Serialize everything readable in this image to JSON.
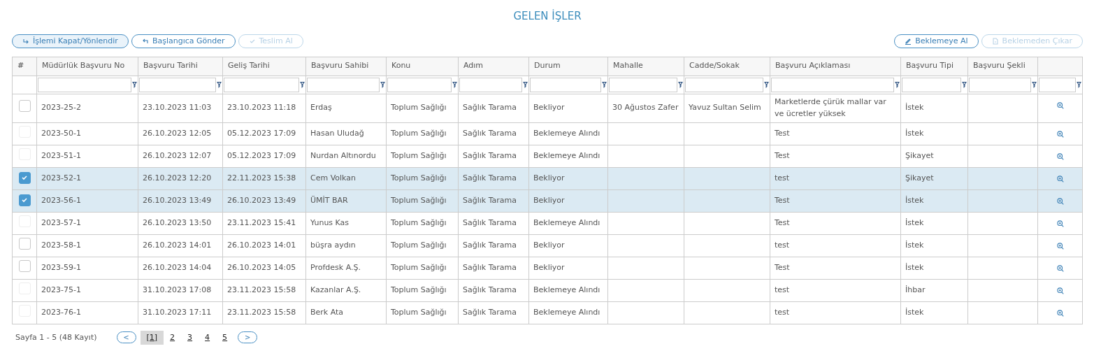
{
  "title": "GELEN İŞLER",
  "left_buttons": [
    {
      "label": "İşlemi Kapat/Yönlendir",
      "disabled": false,
      "selected": true
    },
    {
      "label": "Başlangıca Gönder",
      "disabled": false,
      "selected": false
    },
    {
      "label": "Teslim Al",
      "disabled": true,
      "selected": false
    }
  ],
  "right_buttons": [
    {
      "label": "Beklemeye Al",
      "disabled": false,
      "selected": false
    },
    {
      "label": "Beklemeden Çıkar",
      "disabled": true,
      "selected": false
    }
  ],
  "table": {
    "select_header": "#",
    "columns": [
      "Müdürlük Başvuru No",
      "Başvuru Tarihi",
      "Geliş Tarihi",
      "Başvuru Sahibi",
      "Konu",
      "Adım",
      "Durum",
      "Mahalle",
      "Cadde/Sokak",
      "Başvuru Açıklaması",
      "Başvuru Tipi",
      "Başvuru Şekli"
    ],
    "rows": [
      {
        "checked": false,
        "disabled": false,
        "cells": [
          "2023-25-2",
          "23.10.2023 11:03",
          "23.10.2023 11:18",
          "Erdaş",
          "Toplum Sağlığı",
          "Sağlık Tarama",
          "Bekliyor",
          "30 Ağustos Zafer",
          "Yavuz Sultan Selim",
          "Marketlerde çürük mallar var ve ücretler yüksek",
          "İstek",
          ""
        ]
      },
      {
        "checked": false,
        "disabled": true,
        "cells": [
          "2023-50-1",
          "26.10.2023 12:05",
          "05.12.2023 17:09",
          "Hasan Uludağ",
          "Toplum Sağlığı",
          "Sağlık Tarama",
          "Beklemeye Alındı",
          "",
          "",
          "Test",
          "İstek",
          ""
        ]
      },
      {
        "checked": false,
        "disabled": true,
        "cells": [
          "2023-51-1",
          "26.10.2023 12:07",
          "05.12.2023 17:09",
          "Nurdan Altınordu",
          "Toplum Sağlığı",
          "Sağlık Tarama",
          "Beklemeye Alındı",
          "",
          "",
          "Test",
          "Şikayet",
          ""
        ]
      },
      {
        "checked": true,
        "disabled": false,
        "cells": [
          "2023-52-1",
          "26.10.2023 12:20",
          "22.11.2023 15:38",
          "Cem Volkan",
          "Toplum Sağlığı",
          "Sağlık Tarama",
          "Bekliyor",
          "",
          "",
          "test",
          "Şikayet",
          ""
        ]
      },
      {
        "checked": true,
        "disabled": false,
        "cells": [
          "2023-56-1",
          "26.10.2023 13:49",
          "26.10.2023 13:49",
          "ÜMİT BAR",
          "Toplum Sağlığı",
          "Sağlık Tarama",
          "Bekliyor",
          "",
          "",
          "Test",
          "İstek",
          ""
        ]
      },
      {
        "checked": false,
        "disabled": true,
        "cells": [
          "2023-57-1",
          "26.10.2023 13:50",
          "23.11.2023 15:41",
          "Yunus Kas",
          "Toplum Sağlığı",
          "Sağlık Tarama",
          "Beklemeye Alındı",
          "",
          "",
          "Test",
          "İstek",
          ""
        ]
      },
      {
        "checked": false,
        "disabled": false,
        "cells": [
          "2023-58-1",
          "26.10.2023 14:01",
          "26.10.2023 14:01",
          "büşra aydın",
          "Toplum Sağlığı",
          "Sağlık Tarama",
          "Bekliyor",
          "",
          "",
          "test",
          "İstek",
          ""
        ]
      },
      {
        "checked": false,
        "disabled": false,
        "cells": [
          "2023-59-1",
          "26.10.2023 14:04",
          "26.10.2023 14:05",
          "Profdesk A.Ş.",
          "Toplum Sağlığı",
          "Sağlık Tarama",
          "Bekliyor",
          "",
          "",
          "Test",
          "İstek",
          ""
        ]
      },
      {
        "checked": false,
        "disabled": true,
        "cells": [
          "2023-75-1",
          "31.10.2023 17:08",
          "23.11.2023 15:58",
          "Kazanlar A.Ş.",
          "Toplum Sağlığı",
          "Sağlık Tarama",
          "Beklemeye Alındı",
          "",
          "",
          "test",
          "İhbar",
          ""
        ]
      },
      {
        "checked": false,
        "disabled": true,
        "cells": [
          "2023-76-1",
          "31.10.2023 17:11",
          "23.11.2023 15:58",
          "Berk Ata",
          "Toplum Sağlığı",
          "Sağlık Tarama",
          "Beklemeye Alındı",
          "",
          "",
          "test",
          "İstek",
          ""
        ]
      }
    ]
  },
  "pagination": {
    "summary": "Sayfa 1 - 5 (48 Kayıt)",
    "prev": "<",
    "next": ">",
    "pages": [
      {
        "label": "[1]",
        "selected": true
      },
      {
        "label": "2",
        "selected": false
      },
      {
        "label": "3",
        "selected": false
      },
      {
        "label": "4",
        "selected": false
      },
      {
        "label": "5",
        "selected": false
      }
    ]
  }
}
